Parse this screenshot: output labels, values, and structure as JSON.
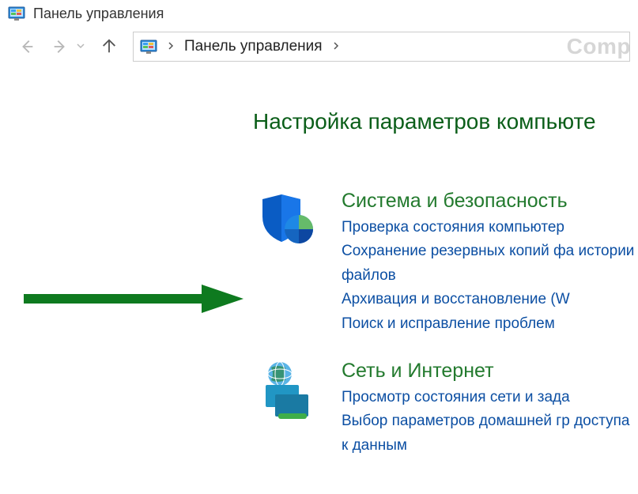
{
  "window": {
    "title": "Панель управления"
  },
  "nav": {
    "breadcrumb_root": "Панель управления",
    "watermark": "Comp"
  },
  "main": {
    "heading": "Настройка параметров компьюте"
  },
  "categories": [
    {
      "title": "Система и безопасность",
      "links": [
        "Проверка состояния компьютер",
        "Сохранение резервных копий фа истории файлов",
        "Архивация и восстановление (W",
        "Поиск и исправление проблем"
      ]
    },
    {
      "title": "Сеть и Интернет",
      "links": [
        "Просмотр состояния сети и зада",
        "Выбор параметров домашней гр доступа к данным"
      ]
    }
  ]
}
